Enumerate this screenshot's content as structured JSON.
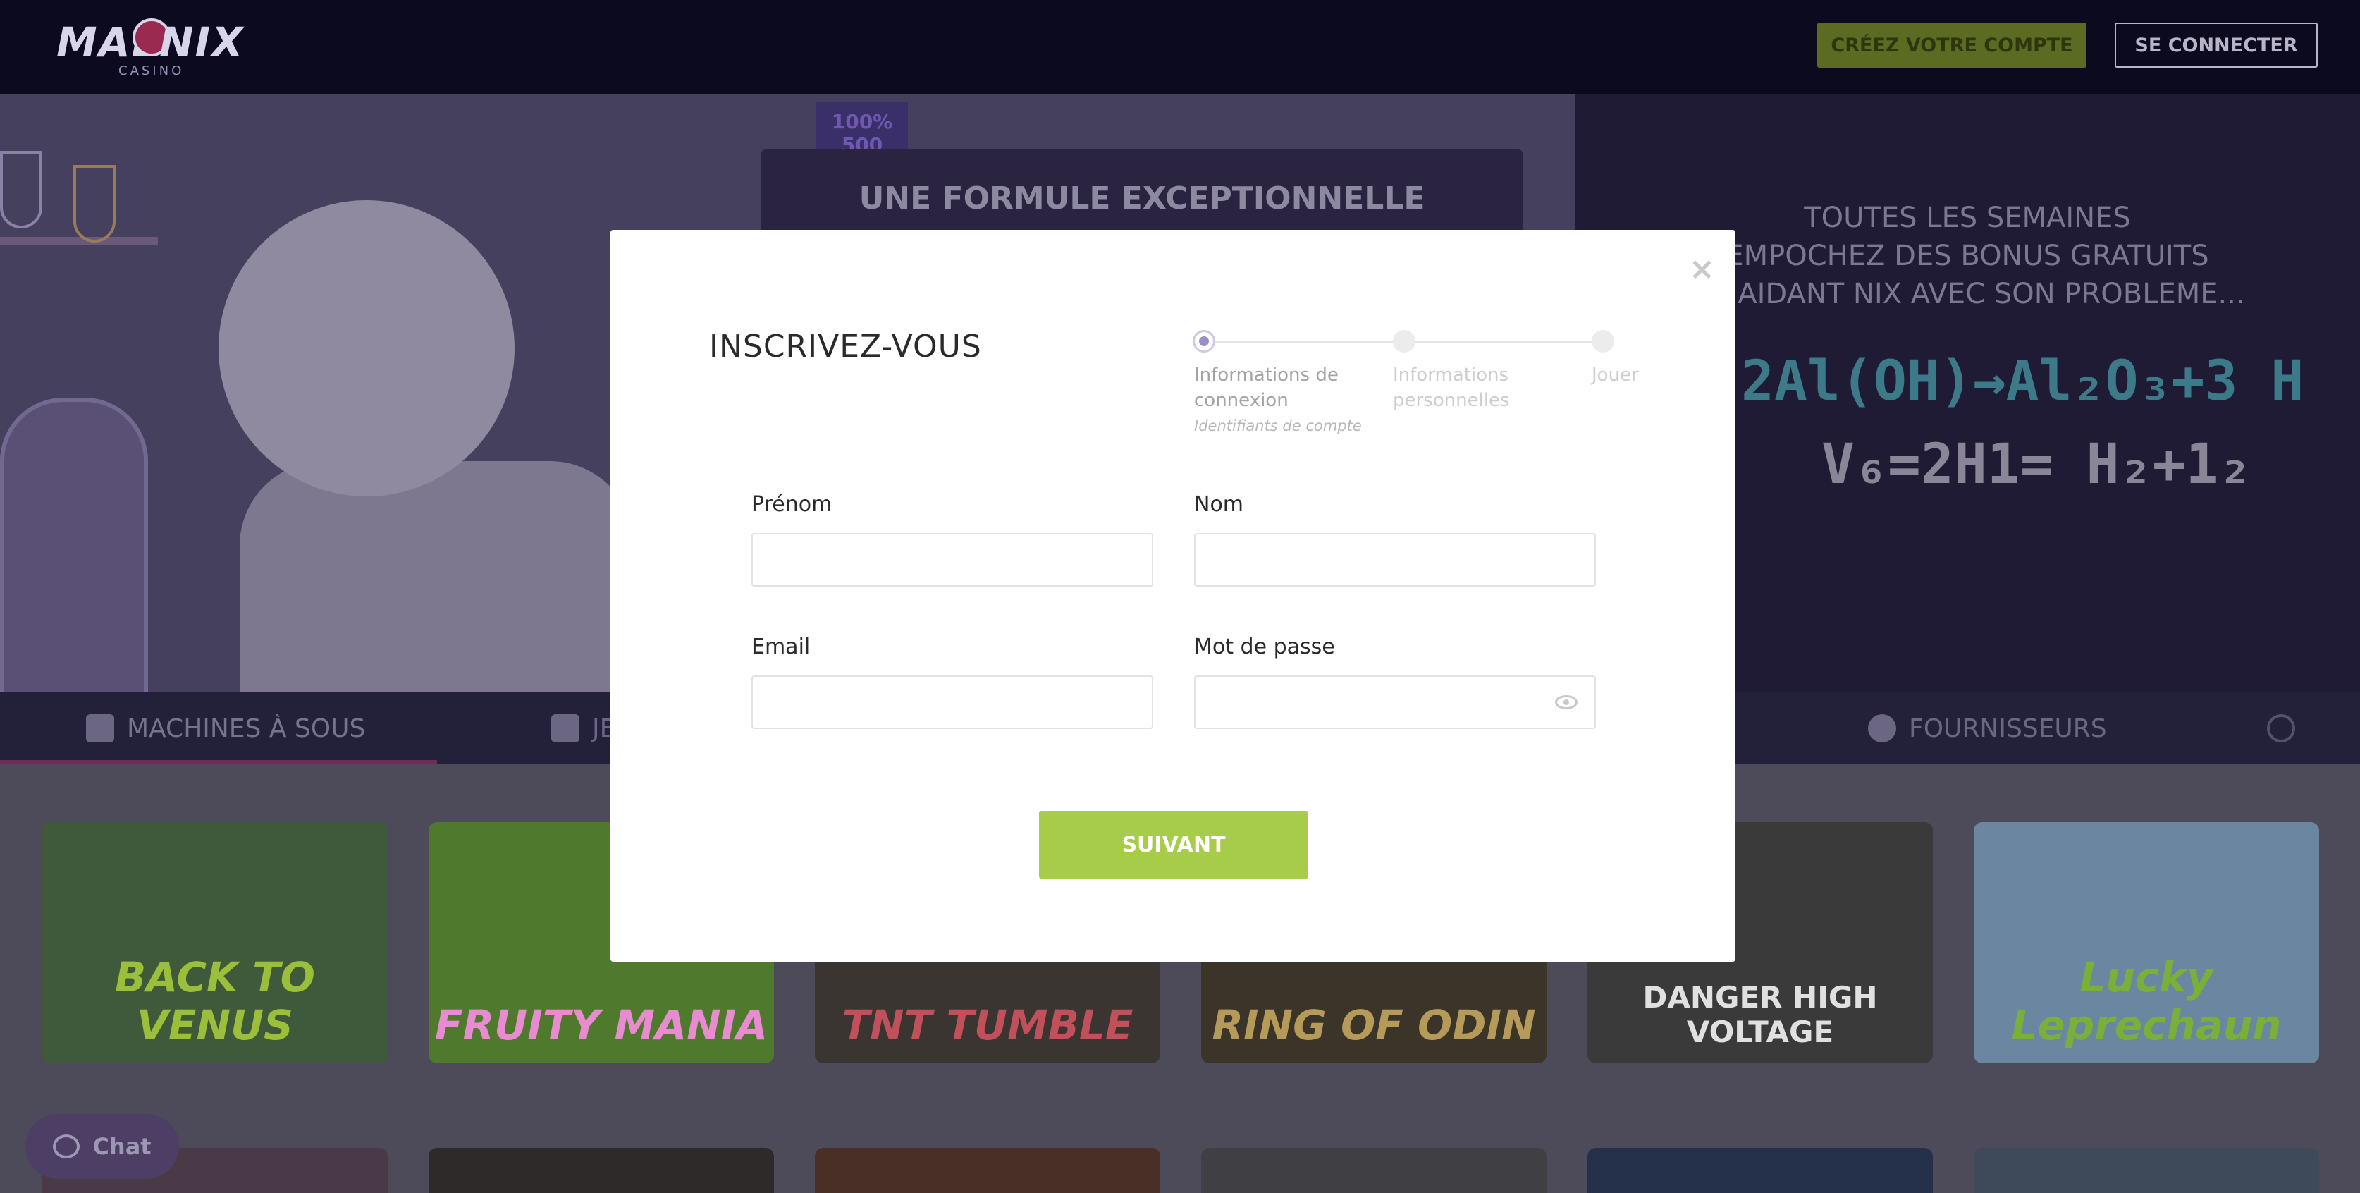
{
  "header": {
    "logo": {
      "mad": "MAD",
      "nix": "NIX",
      "casino": "CASINO"
    },
    "create_account": "CRÉEZ VOTRE COMPTE",
    "login": "SE CONNECTER"
  },
  "banner": {
    "promo_tag": "100% 500",
    "promo_title": "UNE FORMULE EXCEPTIONNELLE",
    "right_lines": [
      "TOUTES LES SEMAINES",
      "EMPOCHEZ DES BONUS GRATUITS",
      "EN AIDANT NIX AVEC SON PROBLEME..."
    ],
    "formula_top": "2Al(OH)→Al₂O₃+3 H",
    "formula_bottom": "V₆=2H1= H₂+1₂"
  },
  "nav": {
    "items": [
      {
        "label": "MACHINES À SOUS",
        "icon": "slot-machine-icon",
        "active": true
      },
      {
        "label": "JE",
        "icon": "cards-icon",
        "active": false
      },
      {
        "label": "FOURNISSEURS",
        "icon": "providers-icon",
        "active": false
      }
    ]
  },
  "games": [
    {
      "name": "BACK TO VENUS",
      "bg": "#3f5a3a",
      "fg": "#9bbf3a"
    },
    {
      "name": "FRUITY MANIA",
      "bg": "#4f7a2e",
      "fg": "#e88bd0"
    },
    {
      "name": "TNT TUMBLE",
      "bg": "#3a3530",
      "fg": "#c0505a"
    },
    {
      "name": "RING OF ODIN",
      "bg": "#3a3429",
      "fg": "#b59a5a"
    },
    {
      "name": "DANGER HIGH VOLTAGE",
      "bg": "#3a3a3a",
      "fg": "#e0e0e0"
    },
    {
      "name": "Lucky Leprechaun",
      "bg": "#6b86a0",
      "fg": "#7ab03a"
    }
  ],
  "chat": {
    "label": "Chat"
  },
  "modal": {
    "title": "INSCRIVEZ-VOUS",
    "close": "×",
    "steps": [
      {
        "label": "Informations de connexion",
        "sub": "Identifiants de compte",
        "active": true
      },
      {
        "label": "Informations personnelles",
        "active": false
      },
      {
        "label": "Jouer",
        "active": false
      }
    ],
    "fields": {
      "first_name": {
        "label": "Prénom",
        "value": ""
      },
      "last_name": {
        "label": "Nom",
        "value": ""
      },
      "email": {
        "label": "Email",
        "value": ""
      },
      "password": {
        "label": "Mot de passe",
        "value": ""
      }
    },
    "next_button": "SUIVANT"
  },
  "colors": {
    "accent_green": "#a6cc4a",
    "header_bg": "#0b0a1f",
    "step_active": "#9b8fc8"
  }
}
